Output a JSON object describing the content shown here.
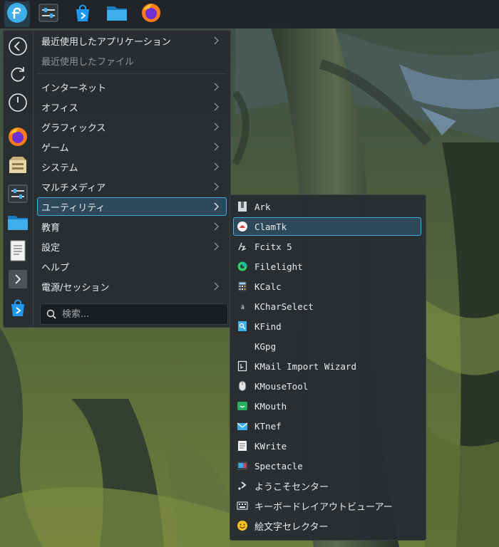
{
  "panel": {
    "icons": [
      "fedora-launcher-icon",
      "system-settings-icon",
      "discover-icon",
      "file-manager-icon",
      "firefox-icon"
    ]
  },
  "favorites": {
    "icons": [
      "back-icon",
      "refresh-icon",
      "power-icon",
      "firefox-icon",
      "archive-icon",
      "settings-icon",
      "folder-icon",
      "document-icon",
      "chevron-right-icon",
      "discover-icon"
    ]
  },
  "categories": {
    "items": [
      {
        "label": "最近使用したアプリケーション",
        "arrow": true
      },
      {
        "label": "最近使用したファイル",
        "arrow": false
      },
      {
        "label": "インターネット",
        "arrow": true
      },
      {
        "label": "オフィス",
        "arrow": true
      },
      {
        "label": "グラフィックス",
        "arrow": true
      },
      {
        "label": "ゲーム",
        "arrow": true
      },
      {
        "label": "システム",
        "arrow": true
      },
      {
        "label": "マルチメディア",
        "arrow": true
      },
      {
        "label": "ユーティリティ",
        "arrow": true
      },
      {
        "label": "教育",
        "arrow": true
      },
      {
        "label": "設定",
        "arrow": true
      },
      {
        "label": "ヘルプ",
        "arrow": false
      },
      {
        "label": "電源/セッション",
        "arrow": true
      }
    ]
  },
  "search": {
    "placeholder": "検索..."
  },
  "submenu": {
    "items": [
      {
        "label": "Ark",
        "icon": "ark-icon"
      },
      {
        "label": "ClamTk",
        "icon": "clamtk-icon"
      },
      {
        "label": "Fcitx 5",
        "icon": "fcitx-icon"
      },
      {
        "label": "Filelight",
        "icon": "filelight-icon"
      },
      {
        "label": "KCalc",
        "icon": "kcalc-icon"
      },
      {
        "label": "KCharSelect",
        "icon": "kcharselect-icon"
      },
      {
        "label": "KFind",
        "icon": "kfind-icon"
      },
      {
        "label": "KGpg",
        "icon": "kgpg-icon"
      },
      {
        "label": "KMail Import Wizard",
        "icon": "kmail-import-icon"
      },
      {
        "label": "KMouseTool",
        "icon": "kmousetool-icon"
      },
      {
        "label": "KMouth",
        "icon": "kmouth-icon"
      },
      {
        "label": "KTnef",
        "icon": "ktnef-icon"
      },
      {
        "label": "KWrite",
        "icon": "kwrite-icon"
      },
      {
        "label": "Spectacle",
        "icon": "spectacle-icon"
      },
      {
        "label": "ようこそセンター",
        "icon": "welcome-center-icon"
      },
      {
        "label": "キーボードレイアウトビューアー",
        "icon": "keyboard-icon"
      },
      {
        "label": "絵文字セレクター",
        "icon": "emoji-icon"
      }
    ]
  },
  "colors": {
    "accent": "#3daee9",
    "panel": "#202327",
    "menu": "#282c31"
  }
}
